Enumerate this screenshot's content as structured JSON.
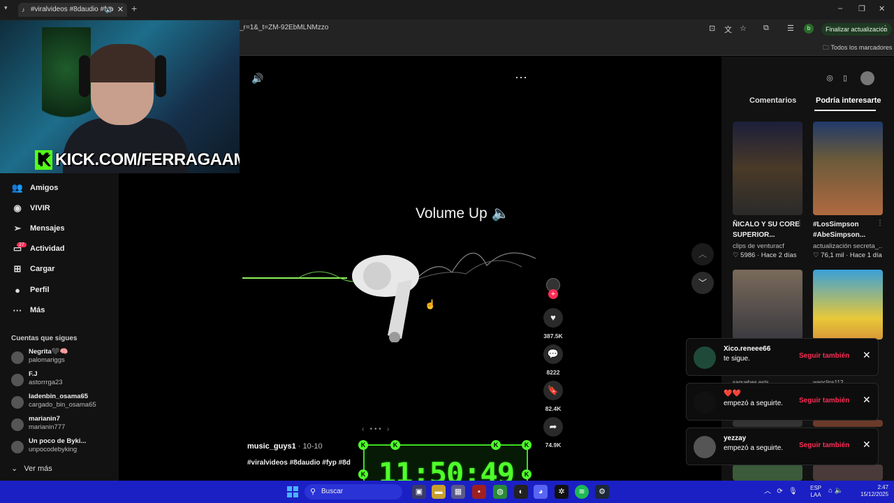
{
  "browser": {
    "tab_title": "#viralvideos #8daudio #fyp",
    "url": "_r=1&_t=ZM-92EbMLNMzzo",
    "update_label": "Finalizar actualización",
    "profile_letter": "b",
    "bookmarks_label": "Todos los marcadores"
  },
  "webcam": {
    "overlay_text": "KICK.COM/FERRAGAAMO",
    "kick_letter": "K"
  },
  "nav": {
    "items": [
      {
        "label": "Amigos",
        "icon": "friends-icon"
      },
      {
        "label": "VIVIR",
        "icon": "live-icon"
      },
      {
        "label": "Mensajes",
        "icon": "send-icon"
      },
      {
        "label": "Actividad",
        "icon": "activity-icon",
        "badge": "27"
      },
      {
        "label": "Cargar",
        "icon": "upload-icon"
      },
      {
        "label": "Perfil",
        "icon": "profile-icon"
      },
      {
        "label": "Más",
        "icon": "more-icon"
      }
    ],
    "following_title": "Cuentas que sigues",
    "following": [
      {
        "name": "Negrita🖤🧠",
        "handle": "palomariggs"
      },
      {
        "name": "F.J",
        "handle": "astorrrga23"
      },
      {
        "name": "ladenbin_osama65",
        "handle": "cargado_bin_osama65"
      },
      {
        "name": "marianin7",
        "handle": "marianin777"
      },
      {
        "name": "Un poco de Byki...",
        "handle": "unpocodebyking"
      }
    ],
    "see_more": "Ver más"
  },
  "video": {
    "overlay_text": "Volume Up 🔈",
    "likes": "387.5K",
    "comments": "8222",
    "saves": "82.4K",
    "shares": "74.9K",
    "username": "music_guys1",
    "date": " · 10-10",
    "hashtags": "#viralvideos #8daudio #fyp #8d",
    "clock": "11:50:49"
  },
  "right_panel": {
    "tab_comments": "Comentarios",
    "tab_interest": "Podría interesarte",
    "cards": [
      {
        "title": "ÑICALO Y SU CORE SUPERIOR...",
        "author": "clips de venturacf",
        "likes": "5986",
        "age": "Hace 2 días"
      },
      {
        "title": "#LosSimpson #AbeSimpson...",
        "author": "actualización secreta_...",
        "likes": "76,1 mil",
        "age": "Hace 1 día"
      },
      {
        "title": "",
        "author": "saquehes ests",
        "likes": "",
        "age": ""
      },
      {
        "title": "",
        "author": "wanclips112",
        "likes": "",
        "age": ""
      }
    ]
  },
  "notifications": [
    {
      "user": "Xico.reneee66",
      "text": "te sigue.",
      "action": "Seguir también"
    },
    {
      "user": "❤️❤️",
      "text": "empezó a seguirte.",
      "action": "Seguir también"
    },
    {
      "user": "yezzay",
      "text": "empezó a seguirte.",
      "action": "Seguir también"
    }
  ],
  "taskbar": {
    "search_placeholder": "Buscar",
    "lang_line1": "ESP",
    "lang_line2": "LAA",
    "time": "2:47",
    "date": "15/12/2025"
  },
  "colors": {
    "accent_pink": "#fe2c55",
    "clock_green": "#4fff2a",
    "taskbar_blue": "#1b20c4"
  }
}
